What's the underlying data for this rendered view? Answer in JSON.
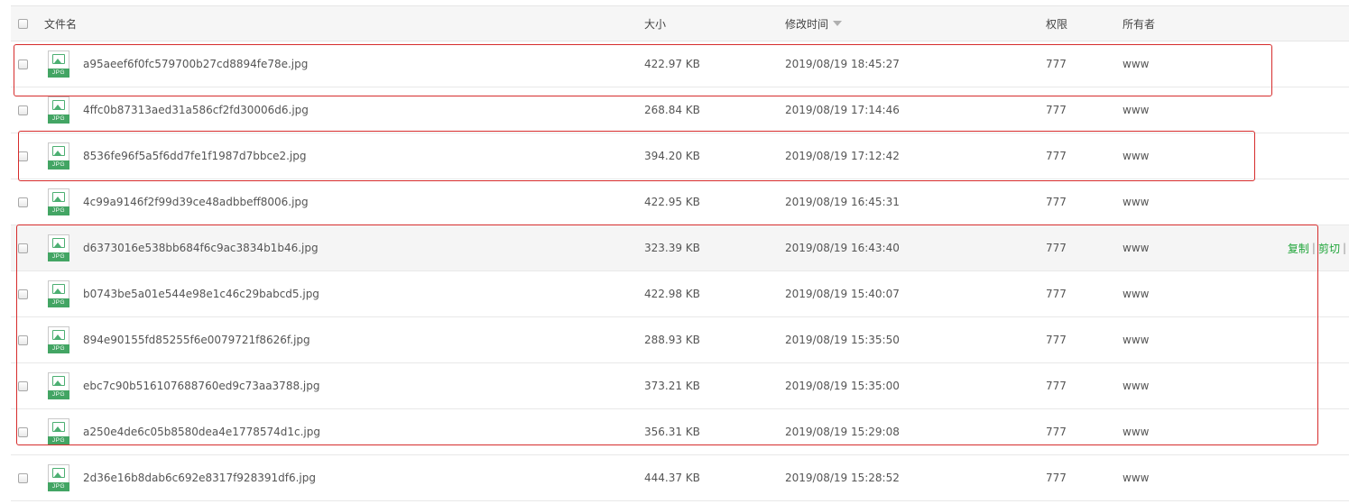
{
  "header": {
    "name": "文件名",
    "size": "大小",
    "time": "修改时间",
    "perm": "权限",
    "owner": "所有者"
  },
  "file_icon_label": "JPG",
  "files": [
    {
      "name": "a95aeef6f0fc579700b27cd8894fe78e.jpg",
      "size": "422.97 KB",
      "time": "2019/08/19 18:45:27",
      "perm": "777",
      "owner": "www"
    },
    {
      "name": "4ffc0b87313aed31a586cf2fd30006d6.jpg",
      "size": "268.84 KB",
      "time": "2019/08/19 17:14:46",
      "perm": "777",
      "owner": "www"
    },
    {
      "name": "8536fe96f5a5f6dd7fe1f1987d7bbce2.jpg",
      "size": "394.20 KB",
      "time": "2019/08/19 17:12:42",
      "perm": "777",
      "owner": "www"
    },
    {
      "name": "4c99a9146f2f99d39ce48adbbeff8006.jpg",
      "size": "422.95 KB",
      "time": "2019/08/19 16:45:31",
      "perm": "777",
      "owner": "www"
    },
    {
      "name": "d6373016e538bb684f6c9ac3834b1b46.jpg",
      "size": "323.39 KB",
      "time": "2019/08/19 16:43:40",
      "perm": "777",
      "owner": "www"
    },
    {
      "name": "b0743be5a01e544e98e1c46c29babcd5.jpg",
      "size": "422.98 KB",
      "time": "2019/08/19 15:40:07",
      "perm": "777",
      "owner": "www"
    },
    {
      "name": "894e90155fd85255f6e0079721f8626f.jpg",
      "size": "288.93 KB",
      "time": "2019/08/19 15:35:50",
      "perm": "777",
      "owner": "www"
    },
    {
      "name": "ebc7c90b516107688760ed9c73aa3788.jpg",
      "size": "373.21 KB",
      "time": "2019/08/19 15:35:00",
      "perm": "777",
      "owner": "www"
    },
    {
      "name": "a250e4de6c05b8580dea4e1778574d1c.jpg",
      "size": "356.31 KB",
      "time": "2019/08/19 15:29:08",
      "perm": "777",
      "owner": "www"
    },
    {
      "name": "2d36e16b8dab6c692e8317f928391df6.jpg",
      "size": "444.37 KB",
      "time": "2019/08/19 15:28:52",
      "perm": "777",
      "owner": "www"
    }
  ],
  "hover_row_actions": {
    "copy": "复制",
    "cut": "剪切",
    "separator": "|"
  },
  "colors": {
    "action_green": "#20a53a",
    "highlight_red": "#d62c2c",
    "icon_green": "#43a564"
  }
}
